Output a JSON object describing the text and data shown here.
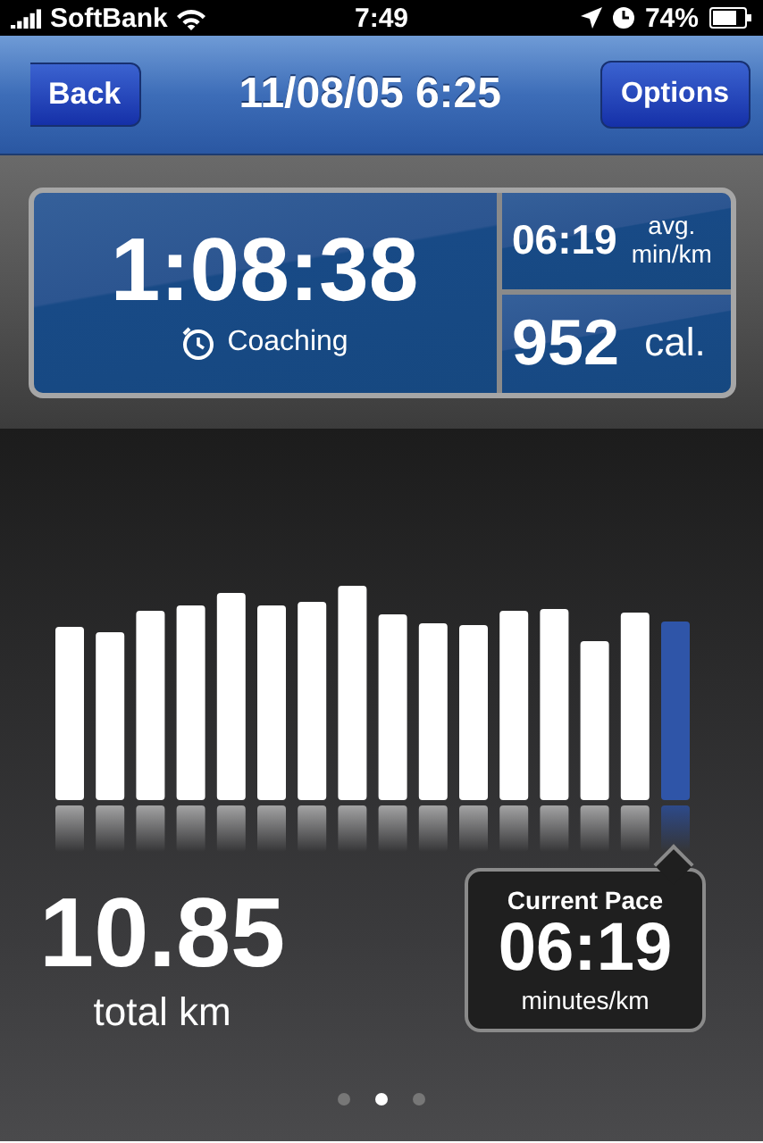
{
  "status_bar": {
    "carrier": "SoftBank",
    "time": "7:49",
    "battery": "74%"
  },
  "nav_bar": {
    "back": "Back",
    "title": "11/08/05 6:25",
    "options": "Options"
  },
  "summary": {
    "duration": "1:08:38",
    "coaching": "Coaching",
    "avg_pace": "06:19",
    "avg_pace_label_1": "avg.",
    "avg_pace_label_2": "min/km",
    "calories": "952",
    "calories_unit": "cal."
  },
  "distance": {
    "value": "10.85",
    "unit": "total km"
  },
  "current_pace": {
    "title": "Current Pace",
    "value": "06:19",
    "unit": "minutes/km"
  },
  "page_dots": [
    {
      "selected": false
    },
    {
      "selected": true
    },
    {
      "selected": false
    }
  ]
}
